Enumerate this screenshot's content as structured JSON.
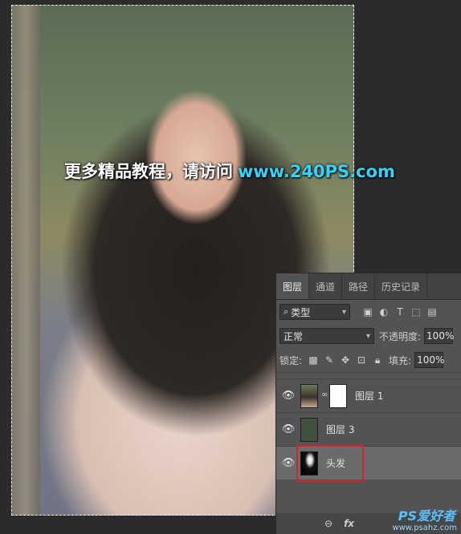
{
  "canvas": {
    "watermark_cn": "更多精品教程，请访问",
    "watermark_url": "www.240PS.com"
  },
  "panel": {
    "tabs": [
      "图层",
      "通道",
      "路径",
      "历史记录"
    ],
    "active_tab": "图层",
    "filter_kind": "类型",
    "blend_mode": "正常",
    "opacity_label": "不透明度:",
    "opacity_value": "100%",
    "lock_label": "锁定:",
    "fill_label": "填充:",
    "fill_value": "100%",
    "layers": [
      {
        "name": "图层 1",
        "has_mask": true,
        "thumb": "photo"
      },
      {
        "name": "图层 3",
        "has_mask": false,
        "thumb": "dark-green"
      },
      {
        "name": "头发",
        "has_mask": false,
        "thumb": "bw-mask",
        "selected": true
      }
    ],
    "bottom_fx": "fx",
    "site_logo": "PS爱好者",
    "site_url": "www.psahz.com"
  },
  "colors": {
    "watermark_url": "#35d3ff",
    "highlight_box": "#d8232a",
    "layer3_thumb": "#41513d"
  }
}
